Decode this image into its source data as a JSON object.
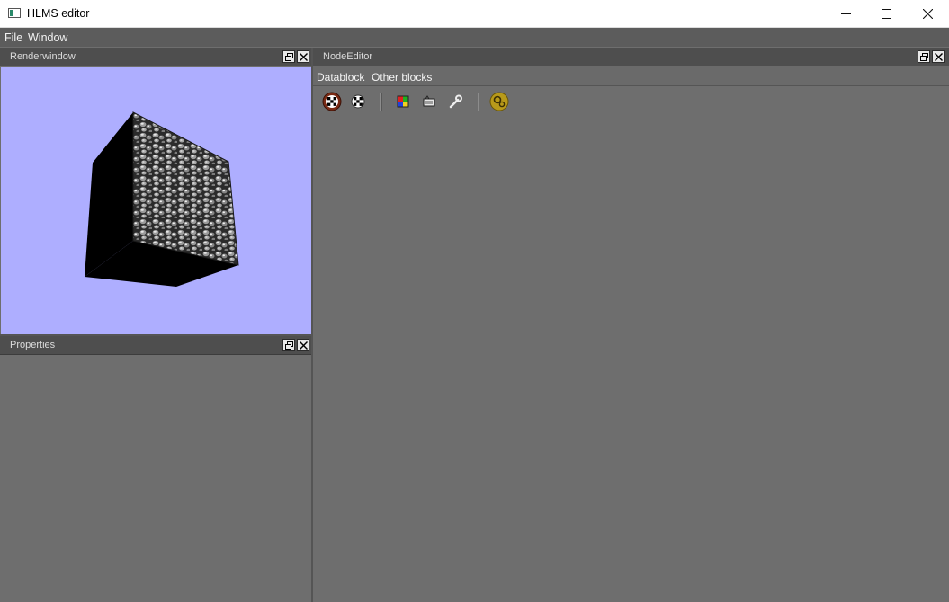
{
  "window": {
    "title": "HLMS editor",
    "controls": {
      "minimize": "minimize-icon",
      "maximize": "maximize-icon",
      "close": "close-icon"
    }
  },
  "menubar": {
    "items": [
      "File",
      "Window"
    ]
  },
  "panels": {
    "renderwindow": {
      "title": "Renderwindow",
      "background": "#aeaeff"
    },
    "properties": {
      "title": "Properties"
    },
    "node_editor": {
      "title": "NodeEditor",
      "menu": [
        "Datablock",
        "Other blocks"
      ],
      "toolbar": [
        {
          "icon": "pbs-datablock-icon"
        },
        {
          "icon": "unlit-datablock-icon"
        },
        {
          "icon": "color-sampler-icon"
        },
        {
          "icon": "texture-block-icon"
        },
        {
          "icon": "wrench-icon"
        },
        {
          "icon": "compile-gears-icon"
        }
      ]
    }
  },
  "colors": {
    "panel_bg": "#6e6e6e",
    "header_bg": "#4e4e4e",
    "accent_gold": "#b89a1a"
  }
}
